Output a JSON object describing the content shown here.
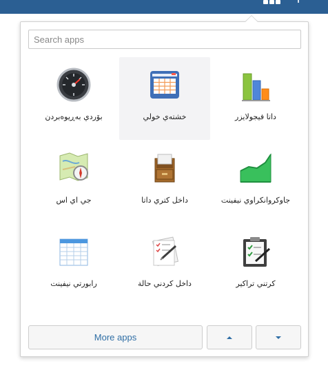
{
  "search": {
    "placeholder": "Search apps",
    "value": ""
  },
  "apps": [
    {
      "label": "بۆردي بەڕيوەبردن",
      "icon": "dashboard-gauge-icon"
    },
    {
      "label": "خشتەي خولي",
      "icon": "schedule-table-icon",
      "active": true
    },
    {
      "label": "داتا فيجولايزر",
      "icon": "bar-chart-icon"
    },
    {
      "label": "جي اي اس",
      "icon": "gis-map-compass-icon"
    },
    {
      "label": "داخل كتري داتا",
      "icon": "file-cabinet-icon"
    },
    {
      "label": "جاوكروانكراوي نيفينت",
      "icon": "area-chart-icon"
    },
    {
      "label": "رابورتي نيفينت",
      "icon": "spreadsheet-icon"
    },
    {
      "label": "داخل كردني حالة",
      "icon": "form-pen-icon"
    },
    {
      "label": "كرتني تراكير",
      "icon": "checklist-clipboard-icon"
    }
  ],
  "footer": {
    "more_label": "More apps",
    "up_icon": "caret-up-icon",
    "down_icon": "caret-down-icon"
  },
  "colors": {
    "topbar": "#2b5f93",
    "link": "#2f6ea5",
    "active_tile": "#f3f3f5"
  }
}
